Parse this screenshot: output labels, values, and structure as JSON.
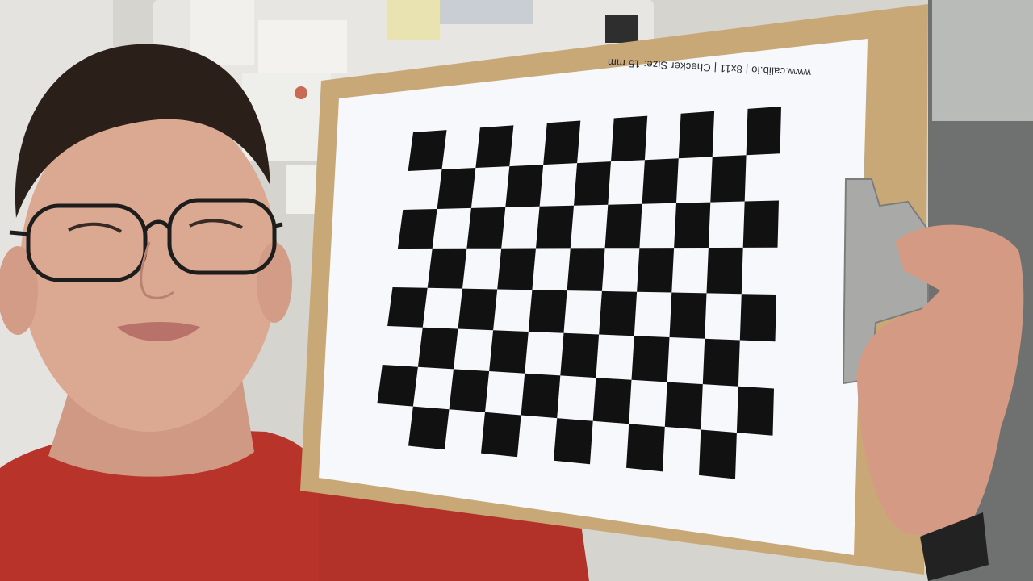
{
  "calibration_sheet": {
    "caption": "www.calib.io | 8x11 | Checker Size: 15 mm",
    "pattern": "checkerboard",
    "rows": 8,
    "columns": 11
  },
  "colors": {
    "wall": "#cfcdc8",
    "clipboard": "#c9a877",
    "paper": "#f7f8fb",
    "checker": "#111111",
    "shirt": "#b8342b",
    "skin": "#d9a58f",
    "hair": "#2b1f1a",
    "clip_metal": "#a9aaa7"
  }
}
